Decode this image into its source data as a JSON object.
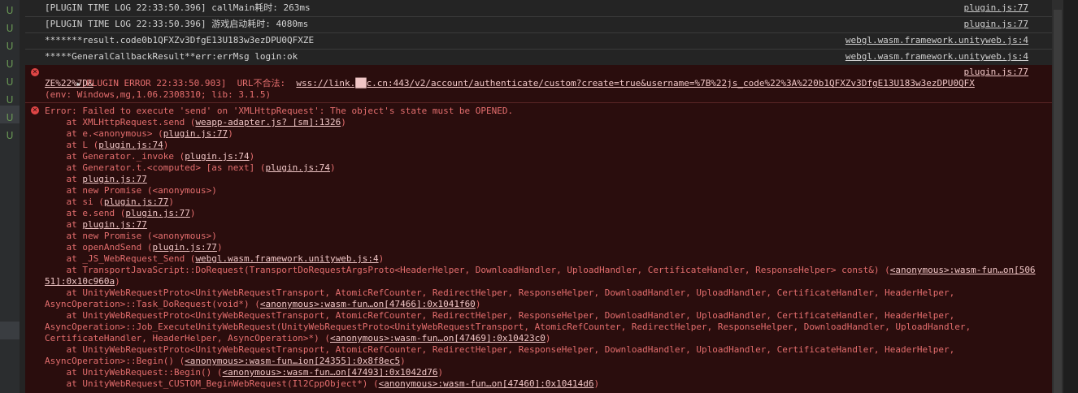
{
  "gutter": {
    "markers": [
      "U",
      "U",
      "U",
      "U",
      "U",
      "U",
      "U",
      "U"
    ]
  },
  "logs": [
    {
      "text": "[PLUGIN TIME LOG 22:33:50.396] callMain耗时: 263ms",
      "source": "plugin.js:77"
    },
    {
      "text": "[PLUGIN TIME LOG 22:33:50.396] 游戏启动耗时: 4080ms",
      "source": "plugin.js:77"
    },
    {
      "text": "*******result.code0b1QFXZv3DfgE13U183w3ezDPU0QFXZE",
      "source": "webgl.wasm.framework.unityweb.js:4"
    },
    {
      "text": "*****GeneralCallbackResult**err:errMsg  login:ok",
      "source": "webgl.wasm.framework.unityweb.js:4"
    }
  ],
  "error1": {
    "prefix": "[PLUGIN ERROR 22:33:50.903]  URL不合法:  ",
    "url_line1": "wss://link.██c.cn:443/v2/account/authenticate/custom?create=true&username=%7B%22js_code%22%3A%220b1QFXZv3DfgE13U183w3ezDPU0QFX",
    "url_line2": "ZE%22%7D&",
    "env": "(env: Windows,mg,1.06.2308310; lib: 3.1.5)",
    "source": "plugin.js:77"
  },
  "error2": {
    "message": "Error: Failed to execute 'send' on 'XMLHttpRequest': The object's state must be OPENED.",
    "stack": [
      {
        "t": "    at XMLHttpRequest.send (",
        "l": "weapp-adapter.js? [sm]:1326",
        "e": ")"
      },
      {
        "t": "    at e.<anonymous> (",
        "l": "plugin.js:77",
        "e": ")"
      },
      {
        "t": "    at L (",
        "l": "plugin.js:74",
        "e": ")"
      },
      {
        "t": "    at Generator._invoke (",
        "l": "plugin.js:74",
        "e": ")"
      },
      {
        "t": "    at Generator.t.<computed> [as next] (",
        "l": "plugin.js:74",
        "e": ")"
      },
      {
        "t": "    at ",
        "l": "plugin.js:77",
        "e": ""
      },
      {
        "t": "    at new Promise (<anonymous>)",
        "l": "",
        "e": ""
      },
      {
        "t": "    at si (",
        "l": "plugin.js:77",
        "e": ")"
      },
      {
        "t": "    at e.send (",
        "l": "plugin.js:77",
        "e": ")"
      },
      {
        "t": "    at ",
        "l": "plugin.js:77",
        "e": ""
      },
      {
        "t": "    at new Promise (<anonymous>)",
        "l": "",
        "e": ""
      },
      {
        "t": "    at openAndSend (",
        "l": "plugin.js:77",
        "e": ")"
      },
      {
        "t": "    at _JS_WebRequest_Send (",
        "l": "webgl.wasm.framework.unityweb.js:4",
        "e": ")"
      },
      {
        "t": "    at TransportJavaScript::DoRequest(TransportDoRequestArgsProto<HeaderHelper, DownloadHandler, UploadHandler, CertificateHandler, ResponseHelper> const&) (",
        "l": "<anonymous>:wasm-fun…on[506",
        "e": ""
      },
      {
        "t": "",
        "l": "51]:0x10c960a",
        "e": ")"
      },
      {
        "t": "    at UnityWebRequestProto<UnityWebRequestTransport, AtomicRefCounter, RedirectHelper, ResponseHelper, DownloadHandler, UploadHandler, CertificateHandler, HeaderHelper,",
        "l": "",
        "e": ""
      },
      {
        "t": "AsyncOperation>::Task_DoRequest(void*) (",
        "l": "<anonymous>:wasm-fun…on[47466]:0x1041f60",
        "e": ")"
      },
      {
        "t": "    at UnityWebRequestProto<UnityWebRequestTransport, AtomicRefCounter, RedirectHelper, ResponseHelper, DownloadHandler, UploadHandler, CertificateHandler, HeaderHelper,",
        "l": "",
        "e": ""
      },
      {
        "t": "AsyncOperation>::Job_ExecuteUnityWebRequest(UnityWebRequestProto<UnityWebRequestTransport, AtomicRefCounter, RedirectHelper, ResponseHelper, DownloadHandler, UploadHandler,",
        "l": "",
        "e": ""
      },
      {
        "t": "CertificateHandler, HeaderHelper, AsyncOperation>*) (",
        "l": "<anonymous>:wasm-fun…on[47469]:0x10423c0",
        "e": ")"
      },
      {
        "t": "    at UnityWebRequestProto<UnityWebRequestTransport, AtomicRefCounter, RedirectHelper, ResponseHelper, DownloadHandler, UploadHandler, CertificateHandler, HeaderHelper,",
        "l": "",
        "e": ""
      },
      {
        "t": "AsyncOperation>::Begin() (",
        "l": "<anonymous>:wasm-fun…ion[24355]:0x8f8ec5",
        "e": ")"
      },
      {
        "t": "    at UnityWebRequest::Begin() (",
        "l": "<anonymous>:wasm-fun…on[47493]:0x1042d76",
        "e": ")"
      },
      {
        "t": "    at UnityWebRequest_CUSTOM_BeginWebRequest(Il2CppObject*) (",
        "l": "<anonymous>:wasm-fun…on[47460]:0x10414d6",
        "e": ")"
      }
    ]
  },
  "icons": {
    "error": "error-circle-icon",
    "expand": "expand-triangle-icon"
  },
  "colors": {
    "error_bg": "#2a0d0d",
    "error_text": "#e46e6e",
    "gutter_marker": "#6a9955"
  }
}
